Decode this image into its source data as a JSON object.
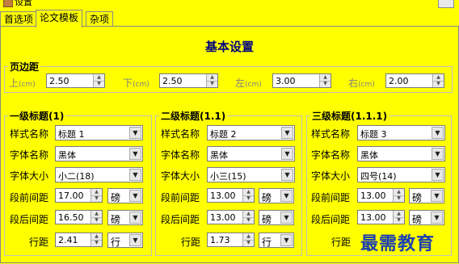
{
  "window": {
    "title": "设置"
  },
  "tabs": [
    {
      "label": "首选项"
    },
    {
      "label": "论文模板"
    },
    {
      "label": "杂项"
    }
  ],
  "heading": "基本设置",
  "margins": {
    "title": "页边距",
    "unit": "(cm)",
    "top": {
      "label": "上",
      "value": "2.50"
    },
    "bottom": {
      "label": "下",
      "value": "2.50"
    },
    "left": {
      "label": "左",
      "value": "3.00"
    },
    "right": {
      "label": "右",
      "value": "2.00"
    }
  },
  "labels": {
    "style_name": "样式名称",
    "font_name": "字体名称",
    "font_size": "字体大小",
    "space_before": "段前间距",
    "space_after": "段后间距",
    "line_spacing": "行距"
  },
  "level1": {
    "title": "一级标题(1)",
    "style": "标题 1",
    "font": "黑体",
    "size": "小二(18)",
    "before": "17.00",
    "before_unit": "磅",
    "after": "16.50",
    "after_unit": "磅",
    "line": "2.41",
    "line_unit": "行"
  },
  "level2": {
    "title": "二级标题(1.1)",
    "style": "标题 2",
    "font": "黑体",
    "size": "小三(15)",
    "before": "13.00",
    "before_unit": "磅",
    "after": "13.00",
    "after_unit": "磅",
    "line": "1.73",
    "line_unit": "行"
  },
  "level3": {
    "title": "三级标题(1.1.1)",
    "style": "标题 3",
    "font": "黑体",
    "size": "四号(14)",
    "before": "13.00",
    "before_unit": "磅",
    "after": "13.00",
    "after_unit": "磅"
  },
  "watermark": "最需教育"
}
